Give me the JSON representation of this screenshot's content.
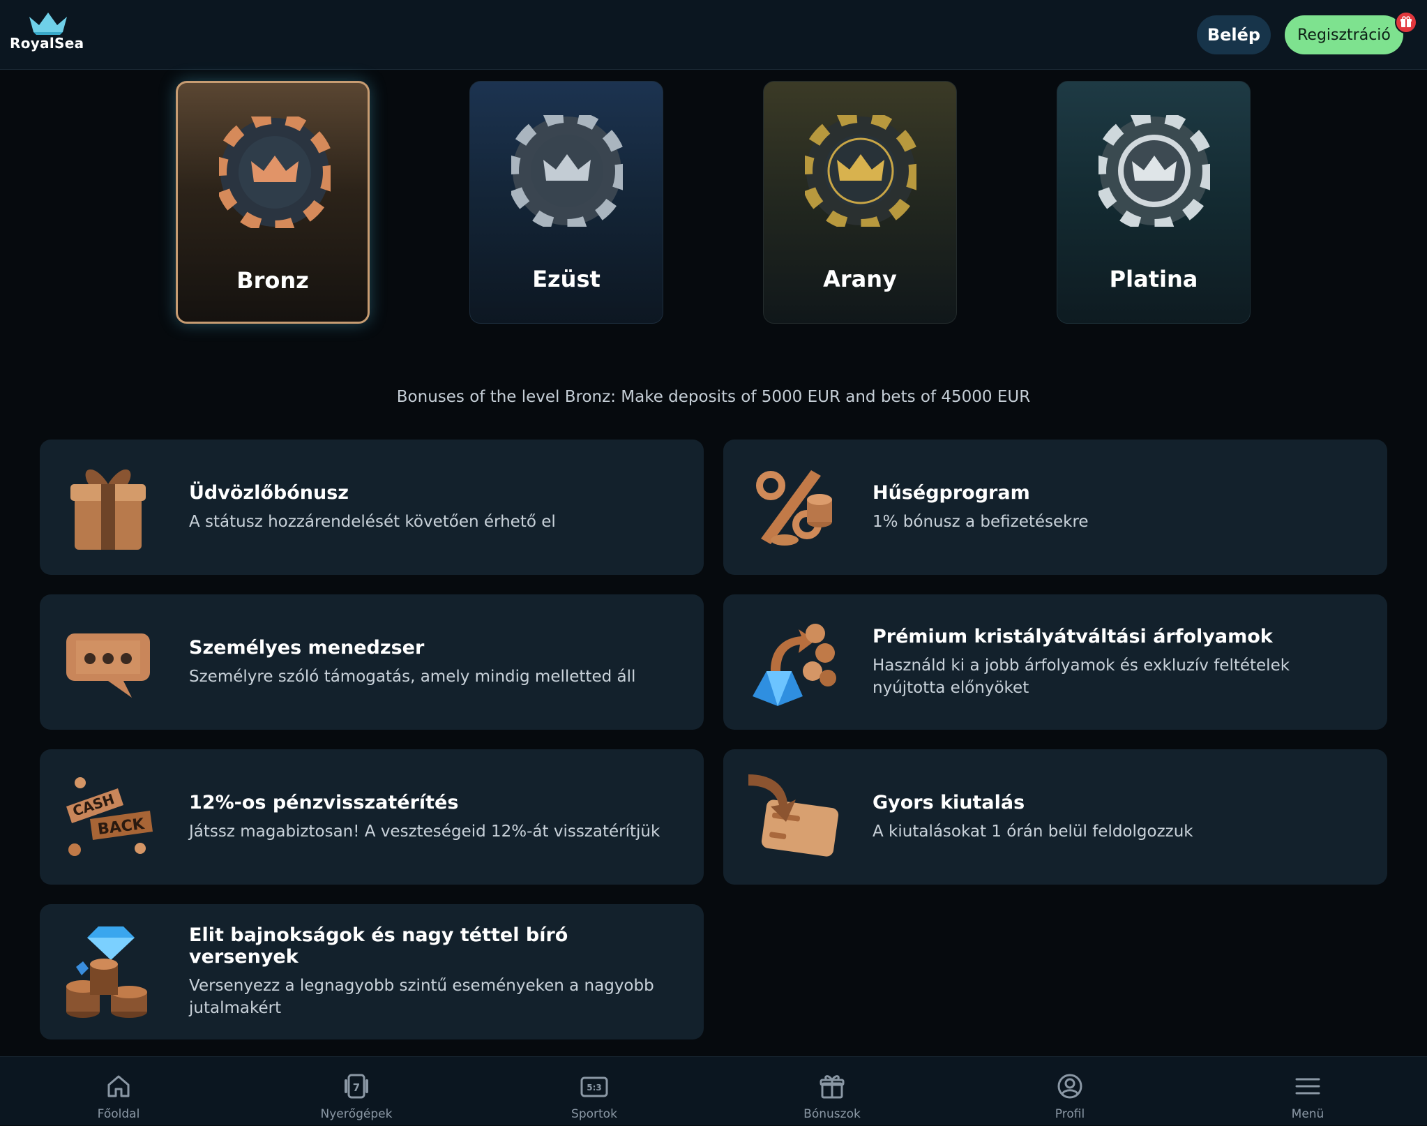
{
  "header": {
    "brand": "RoyalSea",
    "login_label": "Belép",
    "register_label": "Regisztráció"
  },
  "levels": [
    {
      "name": "Bronz",
      "selected": true,
      "accent": "#c98a5a"
    },
    {
      "name": "Ezüst",
      "selected": false,
      "accent": "#b8c4cf"
    },
    {
      "name": "Arany",
      "selected": false,
      "accent": "#c9a646"
    },
    {
      "name": "Platina",
      "selected": false,
      "accent": "#d6dde2"
    }
  ],
  "level_info": "Bonuses of the level Bronz: Make deposits of 5000 EUR and bets of 45000 EUR",
  "bonuses": [
    {
      "icon": "gift-box-icon",
      "title": "Üdvözlőbónusz",
      "desc": "A státusz hozzárendelését követően érhető el"
    },
    {
      "icon": "percent-coins-icon",
      "title": "Hűségprogram",
      "desc": "1% bónusz a befizetésekre"
    },
    {
      "icon": "chat-bubble-icon",
      "title": "Személyes menedzser",
      "desc": "Személyre szóló támogatás, amely mindig melletted áll"
    },
    {
      "icon": "crystal-exchange-icon",
      "title": "Prémium kristályátváltási árfolyamok",
      "desc": "Használd ki a jobb árfolyamok és exkluzív feltételek nyújtotta előnyöket"
    },
    {
      "icon": "cashback-icon",
      "title": "12%-os pénzvisszatérítés",
      "desc": "Játssz magabiztosan! A veszteségeid 12%-át visszatérítjük"
    },
    {
      "icon": "card-withdrawal-icon",
      "title": "Gyors kiutalás",
      "desc": "A kiutalásokat 1 órán belül feldolgozzuk"
    },
    {
      "icon": "diamond-trophy-icon",
      "title": "Elit bajnokságok és nagy téttel bíró versenyek",
      "desc": "Versenyezz a legnagyobb szintű eseményeken a nagyobb jutalmakért"
    }
  ],
  "nav": [
    {
      "icon": "home-icon",
      "label": "Főoldal"
    },
    {
      "icon": "slot-machine-icon",
      "label": "Nyerőgépek"
    },
    {
      "icon": "scoreboard-icon",
      "label": "Sportok"
    },
    {
      "icon": "gift-icon",
      "label": "Bónuszok"
    },
    {
      "icon": "profile-icon",
      "label": "Profil"
    },
    {
      "icon": "menu-icon",
      "label": "Menü"
    }
  ],
  "colors": {
    "background": "#060a0e",
    "card": "#13212c",
    "register_button": "#7ee28f",
    "login_button": "#17344a",
    "badge": "#e2373d"
  }
}
